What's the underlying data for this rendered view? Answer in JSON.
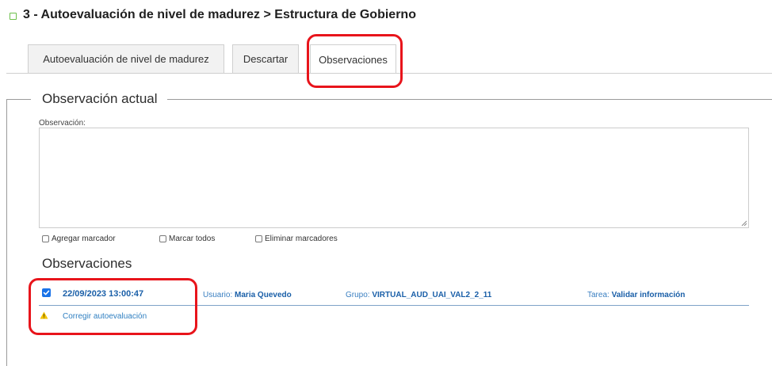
{
  "page": {
    "title": "3 - Autoevaluación de nivel de madurez  > Estructura de Gobierno"
  },
  "tabs": [
    {
      "label": "Autoevaluación de nivel de madurez"
    },
    {
      "label": "Descartar"
    },
    {
      "label": "Observaciones"
    }
  ],
  "form": {
    "legend": "Observación actual",
    "field_label": "Observación:",
    "field_value": "",
    "checkboxes": [
      {
        "label": "Agregar marcador",
        "checked": false
      },
      {
        "label": "Marcar todos",
        "checked": false
      },
      {
        "label": "Eliminar marcadores",
        "checked": false
      }
    ]
  },
  "observations": {
    "heading": "Observaciones",
    "items": [
      {
        "checked": true,
        "datetime": "22/09/2023 13:00:47",
        "user_label": "Usuario:",
        "user": "Maria Quevedo",
        "group_label": "Grupo:",
        "group": "VIRTUAL_AUD_UAI_VAL2_2_11",
        "task_label": "Tarea:",
        "task": "Validar información",
        "note": "Corregir autoevaluación"
      }
    ]
  },
  "colors": {
    "highlight": "#e8141b",
    "link": "#1a5fa8",
    "accent_green": "#6cc04a",
    "warning": "#f2c200"
  },
  "icons": {
    "title_marker": "green-square-icon",
    "warning": "warning-triangle-icon",
    "checkbox_checked": "checkbox-checked-icon"
  }
}
